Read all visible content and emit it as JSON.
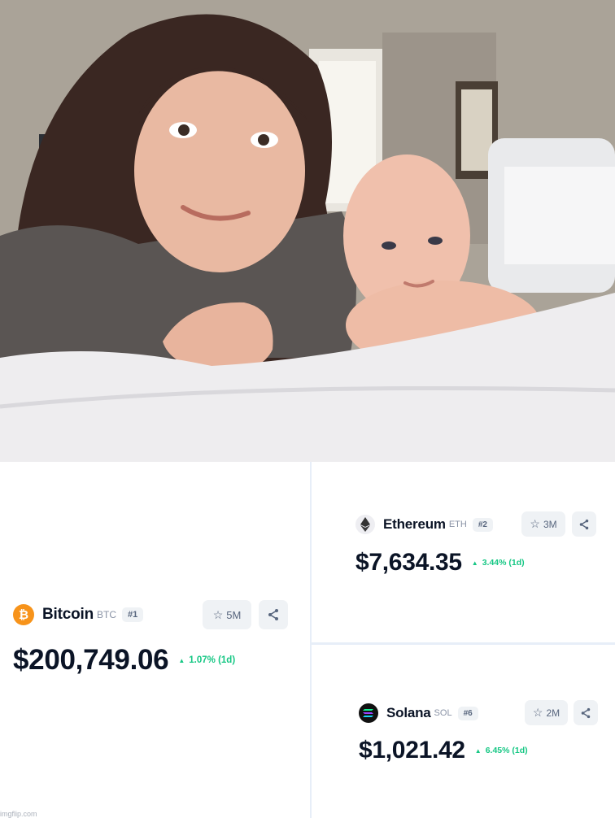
{
  "photo": {
    "description_icon": "photo"
  },
  "coins": {
    "btc": {
      "name": "Bitcoin",
      "symbol": "BTC",
      "rank": "#1",
      "watchlist": "5M",
      "price": "$200,749.06",
      "change": "1.07% (1d)",
      "logo_color": "#f7931a",
      "logo_glyph": "₿"
    },
    "eth": {
      "name": "Ethereum",
      "symbol": "ETH",
      "rank": "#2",
      "watchlist": "3M",
      "price": "$7,634.35",
      "change": "3.44% (1d)",
      "logo_color": "#f0f0f3",
      "logo_glyph": "◆"
    },
    "sol": {
      "name": "Solana",
      "symbol": "SOL",
      "rank": "#6",
      "watchlist": "2M",
      "price": "$1,021.42",
      "change": "6.45% (1d)",
      "logo_color": "#111111",
      "logo_glyph": "≡"
    }
  },
  "colors": {
    "up": "#16c784",
    "divider": "#e7eef8",
    "chip": "#eff2f5"
  },
  "icons": {
    "star": "star-icon",
    "share": "share-icon",
    "up_triangle": "triangle-up-icon"
  },
  "watermark": "imgflip.com"
}
